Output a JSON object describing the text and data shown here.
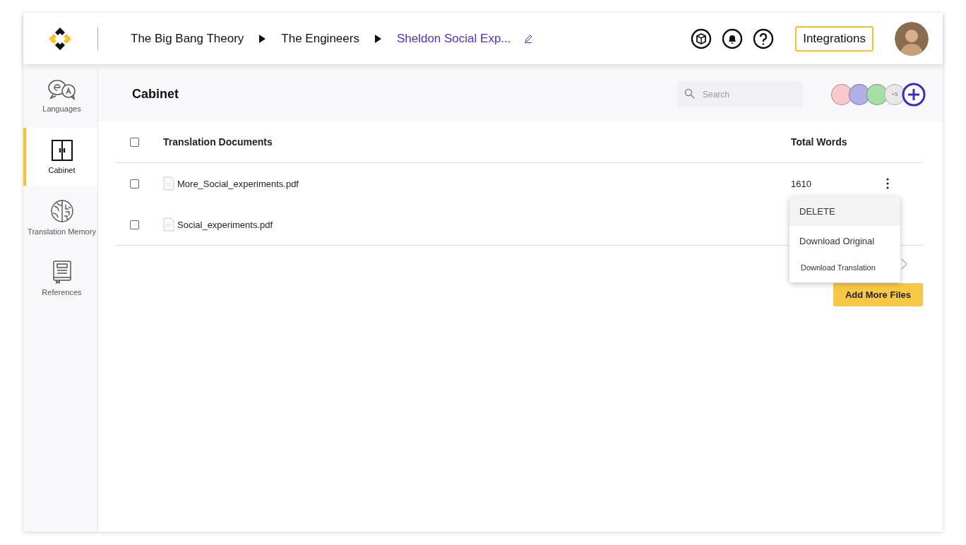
{
  "header": {
    "breadcrumbs": [
      {
        "label": "The Big Bang Theory",
        "current": false
      },
      {
        "label": "The Engineers",
        "current": false
      },
      {
        "label": "Sheldon Social Exp...",
        "current": true
      }
    ],
    "integrations_button": "Integrations"
  },
  "sidebar": {
    "items": [
      {
        "label": "Languages",
        "kind": "languages",
        "selected": false
      },
      {
        "label": "Cabinet",
        "kind": "cabinet",
        "selected": true
      },
      {
        "label": "Translation Memory",
        "kind": "memory",
        "selected": false
      },
      {
        "label": "References",
        "kind": "references",
        "selected": false
      }
    ]
  },
  "cabinet": {
    "title": "Cabinet",
    "search": {
      "placeholder": "Search"
    },
    "collaborators": [
      {
        "color": "#f9c9cc"
      },
      {
        "color": "#b3aee6"
      },
      {
        "color": "#a6dea6"
      }
    ],
    "more_collaborators": "+5"
  },
  "table": {
    "columns": [
      "Translation Documents",
      "Total Words"
    ],
    "header_checked": false,
    "rows": [
      {
        "name": "More_Social_experiments.pdf",
        "total_words": "1610",
        "checked": false
      },
      {
        "name": "Social_experiments.pdf",
        "checked": false
      }
    ]
  },
  "row_menu": {
    "items": [
      {
        "label": "DELETE",
        "selected": true
      },
      {
        "label": "Download Original",
        "selected": false
      },
      {
        "label": "Download Translation",
        "selected": false
      }
    ]
  },
  "add_files_button": "Add More Files"
}
